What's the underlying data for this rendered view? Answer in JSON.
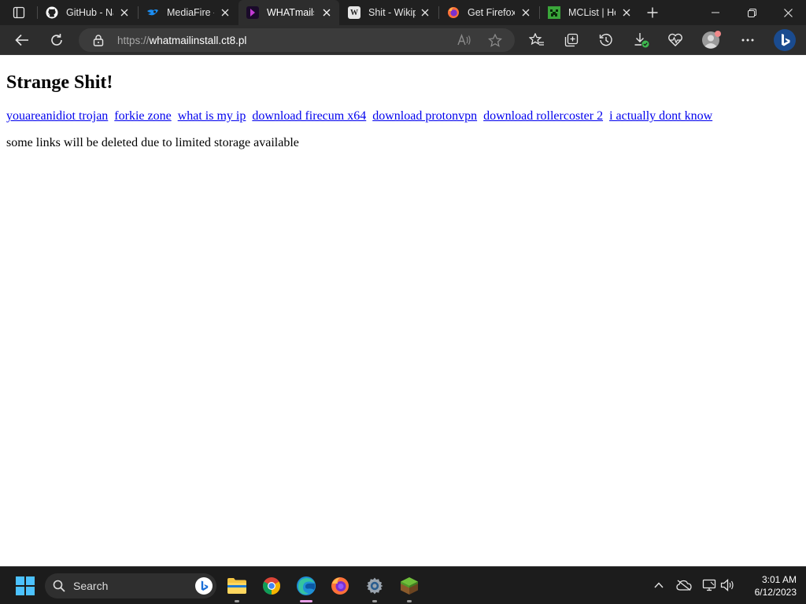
{
  "browser": {
    "tabs": [
      {
        "title": "GitHub - Na",
        "icon": "github-icon",
        "active": false
      },
      {
        "title": "MediaFire -",
        "icon": "mediafire-icon",
        "active": false
      },
      {
        "title": "WHATmails",
        "icon": "whatmails-icon",
        "active": true
      },
      {
        "title": "Shit - Wikip",
        "icon": "wikipedia-icon",
        "active": false
      },
      {
        "title": "Get Firefox",
        "icon": "firefox-icon",
        "active": false
      },
      {
        "title": "MCList | Ho",
        "icon": "mclist-icon",
        "active": false
      }
    ],
    "address": {
      "scheme": "https://",
      "host": "whatmailinstall.ct8.pl"
    },
    "colors": {
      "tabstrip": "#202020",
      "toolbar": "#2d2d2d",
      "address_bg": "#3b3b3b"
    }
  },
  "page": {
    "title": "Strange Shit!",
    "links": [
      "youareanidiot trojan",
      "forkie zone",
      "what is my ip",
      "download firecum x64",
      "download protonvpn",
      "download rollercoster 2",
      "i actually dont know"
    ],
    "notice": "some links will be deleted due to limited storage available",
    "link_color": "#0000ee"
  },
  "taskbar": {
    "search_label": "Search",
    "apps": [
      "file-explorer-icon",
      "chrome-icon",
      "edge-icon",
      "firefox-icon",
      "settings-icon",
      "minecraft-icon"
    ],
    "active_app": "edge-icon",
    "time": "3:01 AM",
    "date": "6/12/2023"
  }
}
